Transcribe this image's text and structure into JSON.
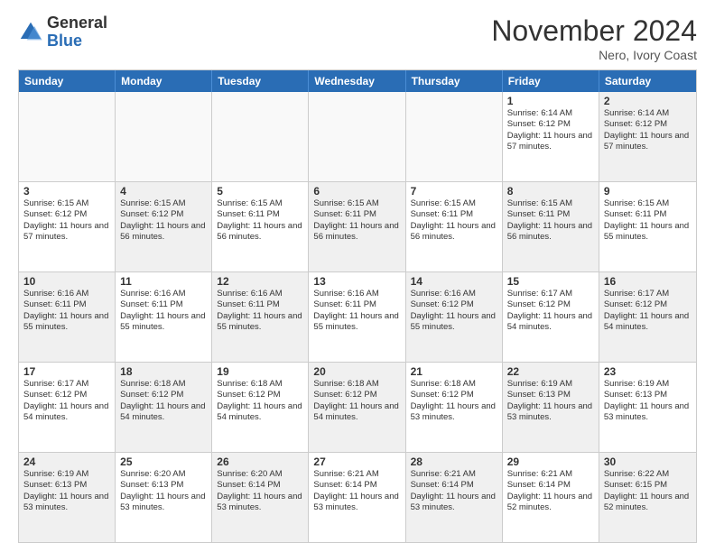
{
  "logo": {
    "general": "General",
    "blue": "Blue"
  },
  "header": {
    "month": "November 2024",
    "location": "Nero, Ivory Coast"
  },
  "weekdays": [
    "Sunday",
    "Monday",
    "Tuesday",
    "Wednesday",
    "Thursday",
    "Friday",
    "Saturday"
  ],
  "rows": [
    [
      {
        "day": "",
        "empty": true
      },
      {
        "day": "",
        "empty": true
      },
      {
        "day": "",
        "empty": true
      },
      {
        "day": "",
        "empty": true
      },
      {
        "day": "",
        "empty": true
      },
      {
        "day": "1",
        "sunrise": "6:14 AM",
        "sunset": "6:12 PM",
        "daylight": "11 hours and 57 minutes."
      },
      {
        "day": "2",
        "sunrise": "6:14 AM",
        "sunset": "6:12 PM",
        "daylight": "11 hours and 57 minutes.",
        "shaded": true
      }
    ],
    [
      {
        "day": "3",
        "sunrise": "6:15 AM",
        "sunset": "6:12 PM",
        "daylight": "11 hours and 57 minutes."
      },
      {
        "day": "4",
        "sunrise": "6:15 AM",
        "sunset": "6:12 PM",
        "daylight": "11 hours and 56 minutes.",
        "shaded": true
      },
      {
        "day": "5",
        "sunrise": "6:15 AM",
        "sunset": "6:11 PM",
        "daylight": "11 hours and 56 minutes."
      },
      {
        "day": "6",
        "sunrise": "6:15 AM",
        "sunset": "6:11 PM",
        "daylight": "11 hours and 56 minutes.",
        "shaded": true
      },
      {
        "day": "7",
        "sunrise": "6:15 AM",
        "sunset": "6:11 PM",
        "daylight": "11 hours and 56 minutes."
      },
      {
        "day": "8",
        "sunrise": "6:15 AM",
        "sunset": "6:11 PM",
        "daylight": "11 hours and 56 minutes.",
        "shaded": true
      },
      {
        "day": "9",
        "sunrise": "6:15 AM",
        "sunset": "6:11 PM",
        "daylight": "11 hours and 55 minutes."
      }
    ],
    [
      {
        "day": "10",
        "sunrise": "6:16 AM",
        "sunset": "6:11 PM",
        "daylight": "11 hours and 55 minutes.",
        "shaded": true
      },
      {
        "day": "11",
        "sunrise": "6:16 AM",
        "sunset": "6:11 PM",
        "daylight": "11 hours and 55 minutes."
      },
      {
        "day": "12",
        "sunrise": "6:16 AM",
        "sunset": "6:11 PM",
        "daylight": "11 hours and 55 minutes.",
        "shaded": true
      },
      {
        "day": "13",
        "sunrise": "6:16 AM",
        "sunset": "6:11 PM",
        "daylight": "11 hours and 55 minutes."
      },
      {
        "day": "14",
        "sunrise": "6:16 AM",
        "sunset": "6:12 PM",
        "daylight": "11 hours and 55 minutes.",
        "shaded": true
      },
      {
        "day": "15",
        "sunrise": "6:17 AM",
        "sunset": "6:12 PM",
        "daylight": "11 hours and 54 minutes."
      },
      {
        "day": "16",
        "sunrise": "6:17 AM",
        "sunset": "6:12 PM",
        "daylight": "11 hours and 54 minutes.",
        "shaded": true
      }
    ],
    [
      {
        "day": "17",
        "sunrise": "6:17 AM",
        "sunset": "6:12 PM",
        "daylight": "11 hours and 54 minutes."
      },
      {
        "day": "18",
        "sunrise": "6:18 AM",
        "sunset": "6:12 PM",
        "daylight": "11 hours and 54 minutes.",
        "shaded": true
      },
      {
        "day": "19",
        "sunrise": "6:18 AM",
        "sunset": "6:12 PM",
        "daylight": "11 hours and 54 minutes."
      },
      {
        "day": "20",
        "sunrise": "6:18 AM",
        "sunset": "6:12 PM",
        "daylight": "11 hours and 54 minutes.",
        "shaded": true
      },
      {
        "day": "21",
        "sunrise": "6:18 AM",
        "sunset": "6:12 PM",
        "daylight": "11 hours and 53 minutes."
      },
      {
        "day": "22",
        "sunrise": "6:19 AM",
        "sunset": "6:13 PM",
        "daylight": "11 hours and 53 minutes.",
        "shaded": true
      },
      {
        "day": "23",
        "sunrise": "6:19 AM",
        "sunset": "6:13 PM",
        "daylight": "11 hours and 53 minutes."
      }
    ],
    [
      {
        "day": "24",
        "sunrise": "6:19 AM",
        "sunset": "6:13 PM",
        "daylight": "11 hours and 53 minutes.",
        "shaded": true
      },
      {
        "day": "25",
        "sunrise": "6:20 AM",
        "sunset": "6:13 PM",
        "daylight": "11 hours and 53 minutes."
      },
      {
        "day": "26",
        "sunrise": "6:20 AM",
        "sunset": "6:14 PM",
        "daylight": "11 hours and 53 minutes.",
        "shaded": true
      },
      {
        "day": "27",
        "sunrise": "6:21 AM",
        "sunset": "6:14 PM",
        "daylight": "11 hours and 53 minutes."
      },
      {
        "day": "28",
        "sunrise": "6:21 AM",
        "sunset": "6:14 PM",
        "daylight": "11 hours and 53 minutes.",
        "shaded": true
      },
      {
        "day": "29",
        "sunrise": "6:21 AM",
        "sunset": "6:14 PM",
        "daylight": "11 hours and 52 minutes."
      },
      {
        "day": "30",
        "sunrise": "6:22 AM",
        "sunset": "6:15 PM",
        "daylight": "11 hours and 52 minutes.",
        "shaded": true
      }
    ]
  ]
}
